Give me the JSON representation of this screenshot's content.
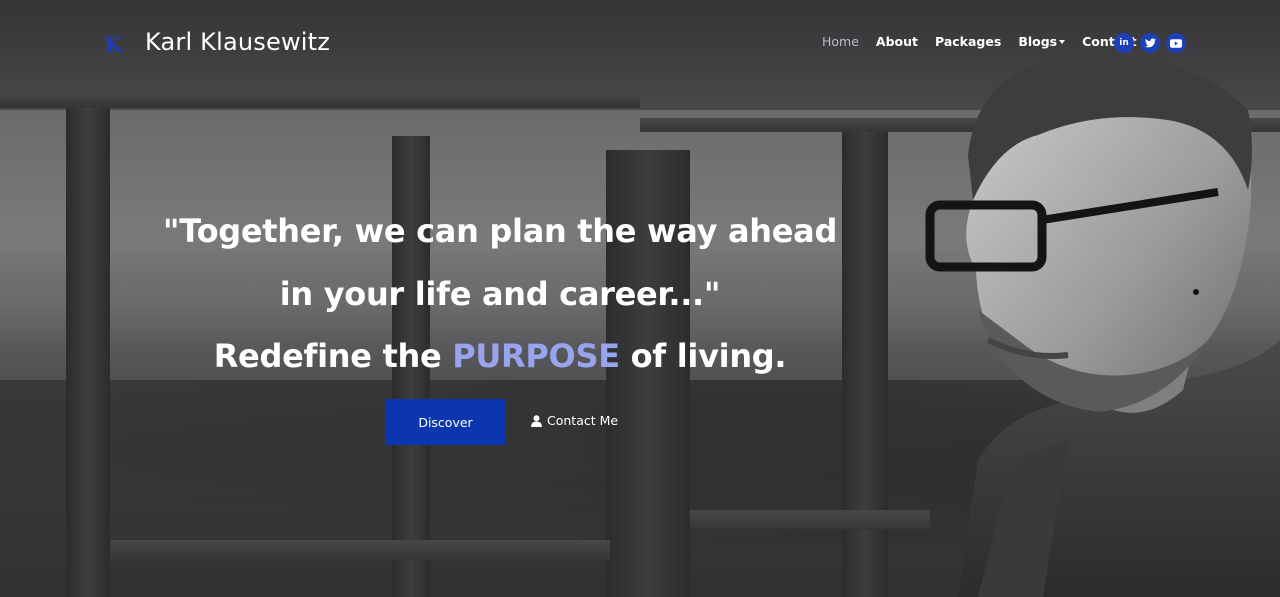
{
  "brand": {
    "logo_letter": "K",
    "name": "Karl Klausewitz"
  },
  "nav": {
    "links": [
      {
        "label": "Home"
      },
      {
        "label": "About"
      },
      {
        "label": "Packages"
      },
      {
        "label": "Blogs"
      },
      {
        "label": "Contact"
      }
    ],
    "social": [
      {
        "icon": "linkedin-icon",
        "glyph": "in"
      },
      {
        "icon": "twitter-icon"
      },
      {
        "icon": "youtube-icon"
      }
    ]
  },
  "hero": {
    "line1": "\"Together, we can plan the way ahead",
    "line2": "in your life and career...\"",
    "line3_before": "Redefine the ",
    "line3_highlight": "PURPOSE",
    "line3_after": " of living.",
    "discover_label": "Discover",
    "contact_label": "Contact Me"
  },
  "colors": {
    "accent": "#0b36b0",
    "highlight": "#98a4ee",
    "social_bg": "#1d3fb8",
    "active_nav": "#b9bccb"
  }
}
